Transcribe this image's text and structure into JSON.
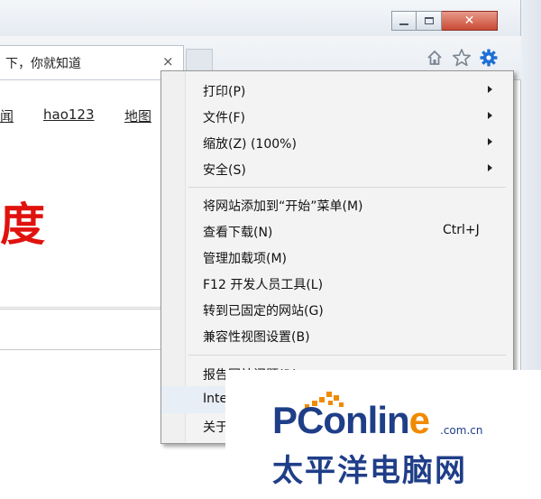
{
  "window": {
    "close_glyph": "✕"
  },
  "tab": {
    "title": "下，你就知道",
    "close_glyph": "×"
  },
  "toolbar": {
    "icons": [
      "home-icon",
      "favorites-star-icon",
      "tools-gear-icon"
    ],
    "gear_color": "#1e6fd6"
  },
  "page": {
    "links": [
      "闻",
      "hao123",
      "地图"
    ],
    "logo_fragment": "度",
    "logo_color": "#e0120e"
  },
  "tools_menu": {
    "items": [
      {
        "label": "打印(P)",
        "shortcut": "",
        "submenu": true
      },
      {
        "label": "文件(F)",
        "shortcut": "",
        "submenu": true
      },
      {
        "label": "缩放(Z) (100%)",
        "shortcut": "",
        "submenu": true
      },
      {
        "label": "安全(S)",
        "shortcut": "",
        "submenu": true
      },
      {
        "label": "将网站添加到“开始”菜单(M)",
        "shortcut": "",
        "submenu": false
      },
      {
        "label": "查看下载(N)",
        "shortcut": "Ctrl+J",
        "submenu": false
      },
      {
        "label": "管理加载项(M)",
        "shortcut": "",
        "submenu": false
      },
      {
        "label": "F12 开发人员工具(L)",
        "shortcut": "",
        "submenu": false
      },
      {
        "label": "转到已固定的网站(G)",
        "shortcut": "",
        "submenu": false
      },
      {
        "label": "兼容性视图设置(B)",
        "shortcut": "",
        "submenu": false
      },
      {
        "label": "报告网站问题(R)",
        "shortcut": "",
        "submenu": false
      },
      {
        "label": "Inte",
        "shortcut": "",
        "submenu": false
      },
      {
        "label": "关于",
        "shortcut": "",
        "submenu": false
      }
    ]
  },
  "watermark": {
    "brand_prefix": "PConlin",
    "brand_accent": "e",
    "domain": ".com.cn",
    "chinese": "太平洋电脑网",
    "brand_color": "#1f3e88",
    "accent_color": "#f08a00"
  }
}
